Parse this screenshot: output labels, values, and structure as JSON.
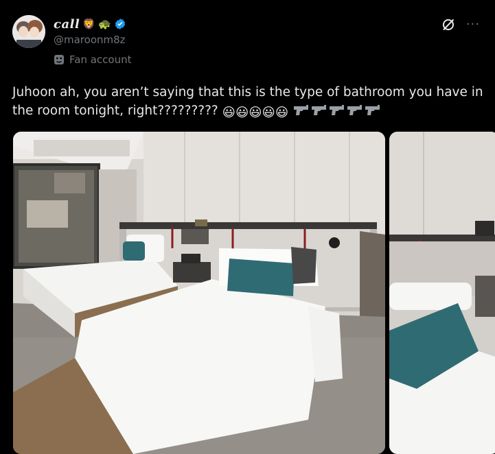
{
  "author": {
    "display_name": "call",
    "name_emojis": [
      "🦁",
      "🐢"
    ],
    "handle": "@maroonm8z",
    "label": "Fan account",
    "verified_color": "#1d9bf0"
  },
  "tweet": {
    "text": "Juhoon ah, you aren’t saying that this is the type of bathroom you have in the room tonight, right?????????",
    "trailing_emojis": [
      "😃",
      "😃",
      "😃",
      "😃",
      "😃"
    ],
    "trailing_icons": [
      "gun-icon",
      "gun-icon",
      "gun-icon",
      "gun-icon",
      "gun-icon"
    ]
  },
  "media": [
    {
      "name": "hotel-room-photo",
      "description_icon": "photo"
    },
    {
      "name": "hotel-room-photo-2",
      "description_icon": "photo"
    }
  ],
  "actions": {
    "more": "···"
  }
}
